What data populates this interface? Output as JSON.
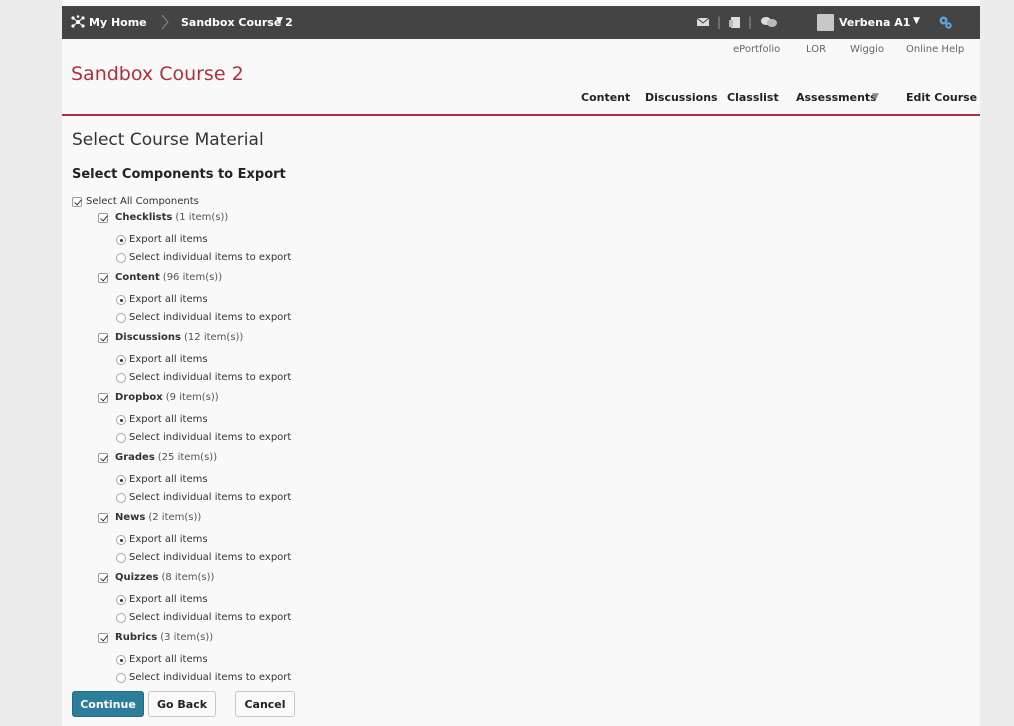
{
  "topbar": {
    "home_label": "My Home",
    "course_label": "Sandbox Course 2",
    "course_caret": "▼",
    "user_label": "Verbena A1",
    "user_caret": "▼",
    "pipe": "|",
    "icons": [
      "home-icon",
      "chevron-right-icon",
      "mail-icon",
      "notebook-icon",
      "chat-icon",
      "avatar",
      "gear-icon"
    ]
  },
  "utility_links": [
    "ePortfolio",
    "LOR",
    "Wiggio",
    "Online Help"
  ],
  "course_title": "Sandbox Course 2",
  "main_nav": {
    "content": "Content",
    "discussions": "Discussions",
    "classlist": "Classlist",
    "assessments": "Assessments",
    "assessments_caret": "▼",
    "edit_course": "Edit Course"
  },
  "page_heading": "Select Course Material",
  "section_heading": "Select Components to Export",
  "select_all": {
    "label": "Select All Components",
    "checked": true
  },
  "components": [
    {
      "name": "Checklists",
      "count": "(1 item(s))",
      "checked": true,
      "export_all": "Export all items",
      "select_individual": "Select individual items to export",
      "selected": "export_all"
    },
    {
      "name": "Content",
      "count": "(96 item(s))",
      "checked": true,
      "export_all": "Export all items",
      "select_individual": "Select individual items to export",
      "selected": "export_all"
    },
    {
      "name": "Discussions",
      "count": "(12 item(s))",
      "checked": true,
      "export_all": "Export all items",
      "select_individual": "Select individual items to export",
      "selected": "export_all"
    },
    {
      "name": "Dropbox",
      "count": "(9 item(s))",
      "checked": true,
      "export_all": "Export all items",
      "select_individual": "Select individual items to export",
      "selected": "export_all"
    },
    {
      "name": "Grades",
      "count": "(25 item(s))",
      "checked": true,
      "export_all": "Export all items",
      "select_individual": "Select individual items to export",
      "selected": "export_all"
    },
    {
      "name": "News",
      "count": "(2 item(s))",
      "checked": true,
      "export_all": "Export all items",
      "select_individual": "Select individual items to export",
      "selected": "export_all"
    },
    {
      "name": "Quizzes",
      "count": "(8 item(s))",
      "checked": true,
      "export_all": "Export all items",
      "select_individual": "Select individual items to export",
      "selected": "export_all"
    },
    {
      "name": "Rubrics",
      "count": "(3 item(s))",
      "checked": true,
      "export_all": "Export all items",
      "select_individual": "Select individual items to export",
      "selected": "export_all"
    }
  ],
  "buttons": {
    "continue": "Continue",
    "go_back": "Go Back",
    "cancel": "Cancel"
  },
  "colors": {
    "brand_red": "#b0303a",
    "topbar": "#444444",
    "primary_button": "#2c7e9a"
  }
}
